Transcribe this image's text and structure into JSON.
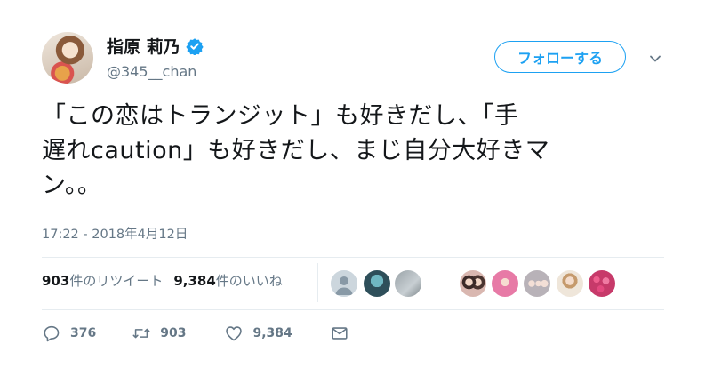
{
  "user": {
    "display_name": "指原 莉乃",
    "handle": "@345__chan",
    "verified": true,
    "avatar_icon": "avatar"
  },
  "follow_button": {
    "label": "フォローする"
  },
  "tweet": {
    "line1": "「この恋はトランジット」も好きだし、「手",
    "line2": "遅れcaution」も好きだし、まじ自分大好きマ",
    "line3": "ン。。"
  },
  "timestamp": "17:22 - 2018年4月12日",
  "stats": {
    "retweet_count": "903",
    "retweet_label": "件のリツイート",
    "like_count": "9,384",
    "like_label": "件のいいね"
  },
  "actions": {
    "reply_count": "376",
    "retweet_count": "903",
    "like_count": "9,384"
  },
  "colors": {
    "accent": "#1da1f2",
    "text": "#14171a",
    "secondary": "#657786",
    "divider": "#e6ecf0"
  }
}
